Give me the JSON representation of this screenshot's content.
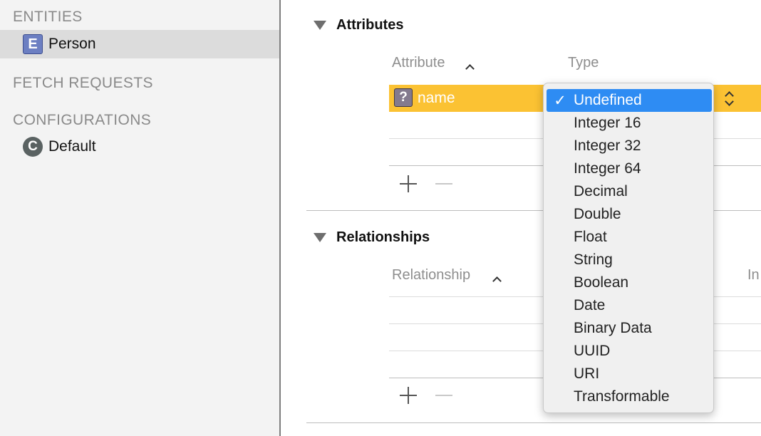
{
  "sidebar": {
    "entities_header": "ENTITIES",
    "entity_item": {
      "badge": "E",
      "label": "Person"
    },
    "fetch_header": "FETCH REQUESTS",
    "config_header": "CONFIGURATIONS",
    "config_item": {
      "badge": "C",
      "label": "Default"
    }
  },
  "attributes": {
    "title": "Attributes",
    "col_attribute": "Attribute",
    "col_type": "Type",
    "row": {
      "badge": "?",
      "name": "name"
    }
  },
  "relationships": {
    "title": "Relationships",
    "col_relationship": "Relationship",
    "col_inverse_partial": "In"
  },
  "type_menu": {
    "checkmark": "✓",
    "selected": "Undefined",
    "items": [
      "Undefined",
      "Integer 16",
      "Integer 32",
      "Integer 64",
      "Decimal",
      "Double",
      "Float",
      "String",
      "Boolean",
      "Date",
      "Binary Data",
      "UUID",
      "URI",
      "Transformable"
    ]
  },
  "colors": {
    "row_highlight": "#fbc233",
    "menu_selection": "#2e8cf3",
    "entity_badge": "#6c7fc2"
  }
}
